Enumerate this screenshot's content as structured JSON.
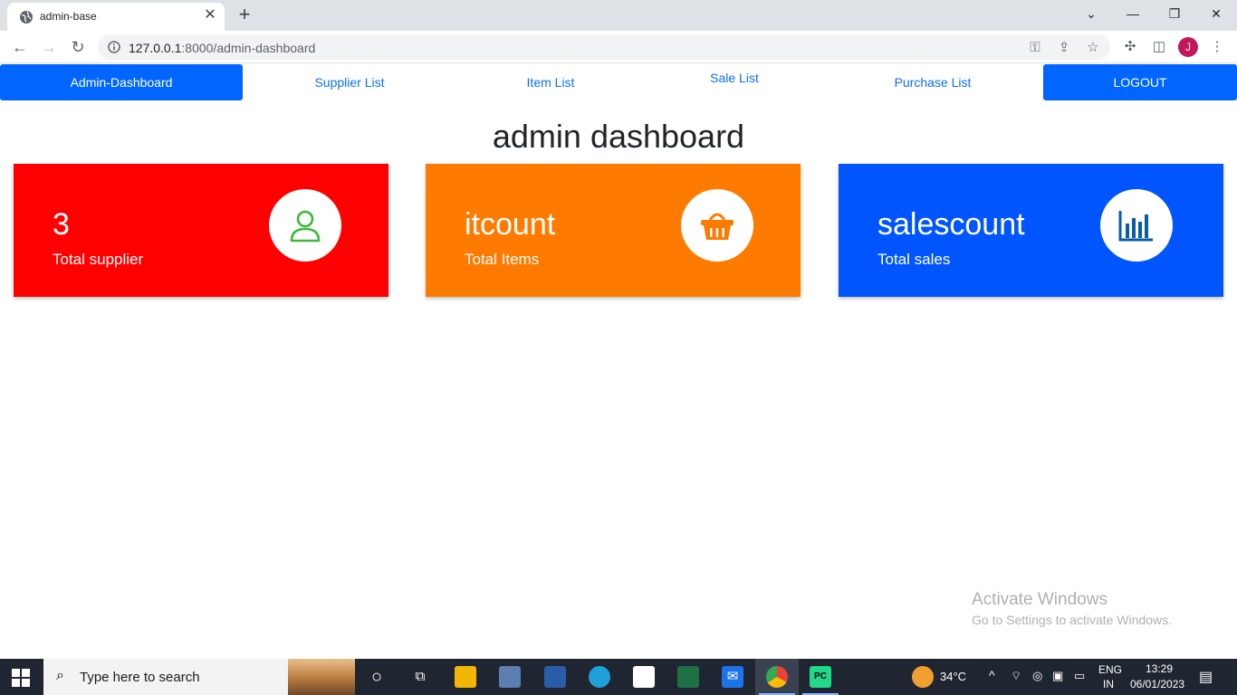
{
  "browser": {
    "tab_title": "admin-base",
    "tab_close": "✕",
    "new_tab": "+",
    "url_host": "127.0.0.1",
    "url_path": ":8000/admin-dashboard",
    "profile_initial": "J"
  },
  "nav": {
    "admin_dashboard": "Admin-Dashboard",
    "supplier_list": "Supplier List",
    "item_list": "Item List",
    "sale_list": "Sale List",
    "purchase_list": "Purchase List",
    "logout": "LOGOUT"
  },
  "page_title": "admin dashboard",
  "cards": [
    {
      "value": "3",
      "label": "Total supplier",
      "color": "#ff0000",
      "icon": "user-icon",
      "icon_color": "#3db83d"
    },
    {
      "value": "itcount",
      "label": "Total Items",
      "color": "#ff7b00",
      "icon": "basket-icon",
      "icon_color": "#ff7b00"
    },
    {
      "value": "salescount",
      "label": "Total sales",
      "color": "#0055ff",
      "icon": "bar-chart-icon",
      "icon_color": "#0a5ea8"
    }
  ],
  "watermark": {
    "line1": "Activate Windows",
    "line2": "Go to Settings to activate Windows."
  },
  "taskbar": {
    "search_placeholder": "Type here to search",
    "temperature": "34°C",
    "lang_top": "ENG",
    "lang_bottom": "IN",
    "time": "13:29",
    "date": "06/01/2023"
  }
}
